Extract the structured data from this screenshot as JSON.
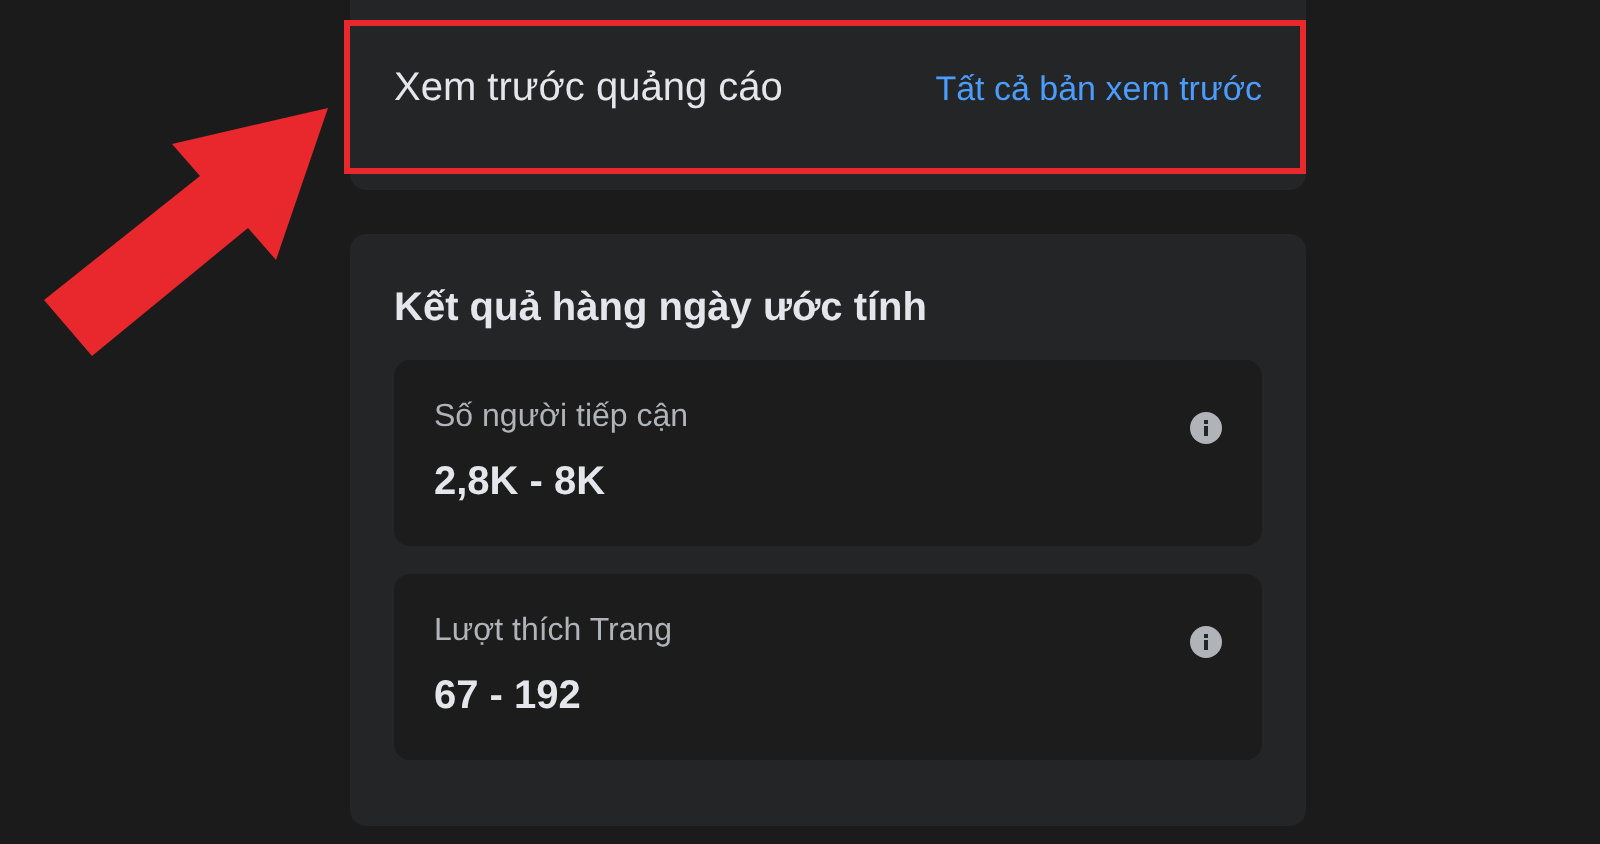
{
  "preview": {
    "title": "Xem trước quảng cáo",
    "link": "Tất cả bản xem trước"
  },
  "results": {
    "title": "Kết quả hàng ngày ước tính",
    "metrics": [
      {
        "label": "Số người tiếp cận",
        "value": "2,8K - 8K"
      },
      {
        "label": "Lượt thích Trang",
        "value": "67 - 192"
      }
    ]
  }
}
